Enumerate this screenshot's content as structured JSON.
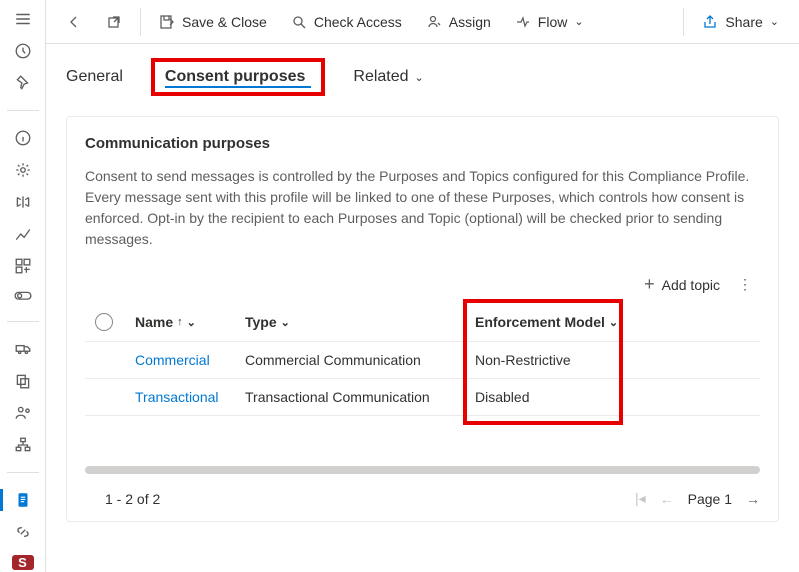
{
  "commandbar": {
    "save_close": "Save & Close",
    "check_access": "Check Access",
    "assign": "Assign",
    "flow": "Flow",
    "share": "Share"
  },
  "tabs": {
    "general": "General",
    "consent": "Consent purposes",
    "related": "Related"
  },
  "card": {
    "title": "Communication purposes",
    "description": "Consent to send messages is controlled by the Purposes and Topics configured for this Compliance Profile. Every message sent with this profile will be linked to one of these Purposes, which controls how consent is enforced. Opt-in by the recipient to each Purposes and Topic (optional) will be checked prior to sending messages."
  },
  "table": {
    "add_topic": "Add topic",
    "headers": {
      "name": "Name",
      "type": "Type",
      "enforcement": "Enforcement Model"
    },
    "rows": [
      {
        "name": "Commercial",
        "type": "Commercial Communication",
        "enforcement": "Non-Restrictive"
      },
      {
        "name": "Transactional",
        "type": "Transactional Communication",
        "enforcement": "Disabled"
      }
    ]
  },
  "pager": {
    "range": "1 - 2 of 2",
    "page": "Page 1"
  },
  "siderail_badge": "S"
}
